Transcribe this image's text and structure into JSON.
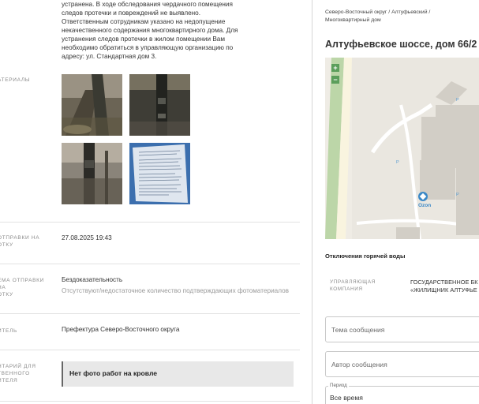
{
  "complaint": {
    "description_lines": [
      "устранена. В ходе обследования чердачного помещения",
      "следов протечки и повреждений не выявлено.",
      "Ответственным сотрудникам указано на недопущение",
      "некачественного содержания многоквартирного дома. Для",
      "устранения следов протечки в жилом помещении Вам",
      "необходимо обратиться в управляющую организацию по",
      "адресу: ул. Стандартная дом 3."
    ],
    "materials_label": "АТЕРИАЛЫ",
    "rows": [
      {
        "label_lines": [
          "ОТПРАВКИ НА",
          "ОТКУ"
        ],
        "value": "27.08.2025 19:43"
      },
      {
        "label_lines": [
          "ЕМА ОТПРАВКИ НА",
          "ОТКУ"
        ],
        "value": "Бездоказательность",
        "sub": "Отсутствуют/недостаточное количество подтверждающих фотоматериалов"
      },
      {
        "label_lines": [
          "ИТЕЛЬ"
        ],
        "value": "Префектура Северо-Восточного округа"
      },
      {
        "label_lines": [
          "НТАРИЙ ДЛЯ",
          "ТВЕННОГО",
          "ИТЕЛЯ"
        ],
        "value": "Нет фото работ на кровле"
      }
    ]
  },
  "building": {
    "breadcrumb_line1": "Северо-Восточный округ / Алтуфьевский /",
    "breadcrumb_line2": "Многоквартирный дом",
    "address": "Алтуфьевское шоссе, дом 66/2",
    "map": {
      "zoom_in": "+",
      "zoom_out": "−",
      "poi_label": "Ozon",
      "marker_p": "P"
    },
    "section_title": "Отключения горячей воды",
    "uk_label_line1": "УПРАВЛЯЮЩАЯ",
    "uk_label_line2": "КОМПАНИЯ",
    "uk_value_line1": "ГОСУДАРСТВЕННОЕ БК",
    "uk_value_line2": "«ЖИЛИЩНИК АЛТУФЬЕ"
  },
  "form": {
    "topic_placeholder": "Тема сообщения",
    "author_placeholder": "Автор сообщения",
    "period_label": "Период",
    "period_value": "Все время"
  },
  "colors": {
    "map_green": "#5b9e5b",
    "poi_blue": "#3a88c7"
  }
}
